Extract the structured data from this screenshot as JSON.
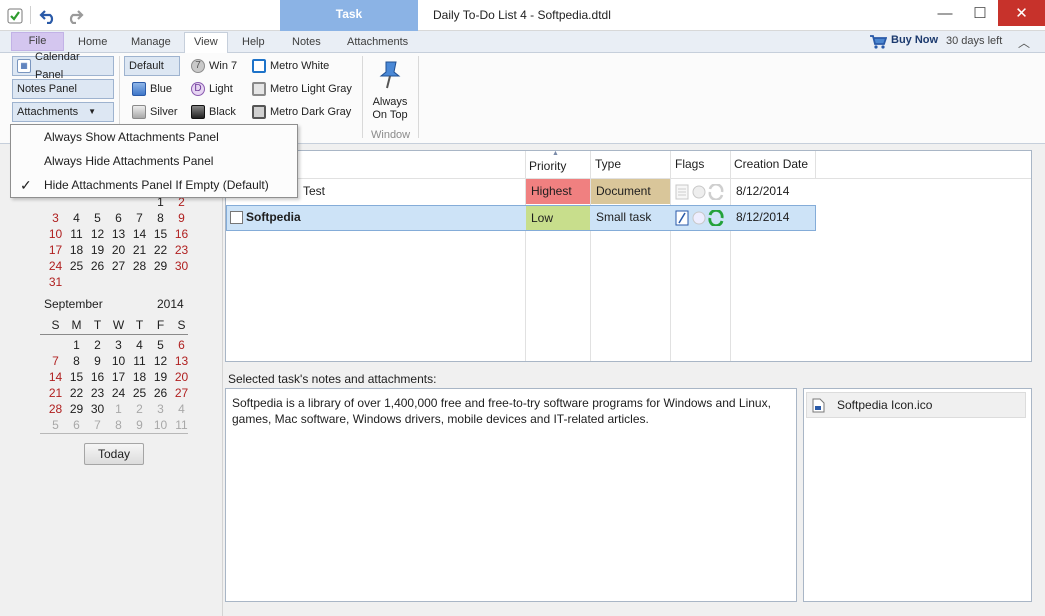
{
  "window": {
    "title": "Daily To-Do List 4 - Softpedia.dtdl",
    "context_tab": "Task",
    "min_glyph": "—",
    "max_glyph": "☐",
    "close_glyph": "✕"
  },
  "ribbon": {
    "tabs": [
      "File",
      "Home",
      "Manage",
      "View",
      "Help",
      "Notes",
      "Attachments"
    ],
    "active_tab": "View",
    "buy_now": "Buy Now",
    "days_left": "30 days left",
    "panels": {
      "calendar_panel": "Calendar Panel",
      "notes_panel": "Notes Panel",
      "attachments": "Attachments"
    },
    "themes": {
      "default": "Default",
      "blue": "Blue",
      "silver": "Silver",
      "win7": "Win 7",
      "light": "Light",
      "black": "Black",
      "metro_white": "Metro White",
      "metro_light_gray": "Metro Light Gray",
      "metro_dark_gray": "Metro Dark Gray"
    },
    "always_on_top_line1": "Always",
    "always_on_top_line2": "On Top",
    "window_group": "Window"
  },
  "dropdown": {
    "items": [
      "Always Show Attachments Panel",
      "Always Hide Attachments Panel",
      "Hide Attachments Panel If Empty (Default)"
    ],
    "checked_index": 2,
    "check_glyph": "✓"
  },
  "calendar": {
    "aug_rows": [
      [
        "",
        "",
        "",
        "",
        "",
        "1",
        "2"
      ],
      [
        "3",
        "4",
        "5",
        "6",
        "7",
        "8",
        "9"
      ],
      [
        "10",
        "11",
        "12",
        "13",
        "14",
        "15",
        "16"
      ],
      [
        "17",
        "18",
        "19",
        "20",
        "21",
        "22",
        "23"
      ],
      [
        "24",
        "25",
        "26",
        "27",
        "28",
        "29",
        "30"
      ],
      [
        "31",
        "",
        "",
        "",
        "",
        "",
        ""
      ]
    ],
    "sep_month": "September",
    "sep_year": "2014",
    "weekdays": [
      "S",
      "M",
      "T",
      "W",
      "T",
      "F",
      "S"
    ],
    "sep_rows": [
      [
        "",
        "1",
        "2",
        "3",
        "4",
        "5",
        "6"
      ],
      [
        "7",
        "8",
        "9",
        "10",
        "11",
        "12",
        "13"
      ],
      [
        "14",
        "15",
        "16",
        "17",
        "18",
        "19",
        "20"
      ],
      [
        "21",
        "22",
        "23",
        "24",
        "25",
        "26",
        "27"
      ],
      [
        "28",
        "29",
        "30",
        "1",
        "2",
        "3",
        "4"
      ],
      [
        "5",
        "6",
        "7",
        "8",
        "9",
        "10",
        "11"
      ]
    ],
    "today_button": "Today"
  },
  "tasks": {
    "columns": [
      "Priority",
      "Type",
      "Flags",
      "Creation Date"
    ],
    "rows": [
      {
        "title": "Test",
        "priority": "Highest",
        "type": "Document",
        "date": "8/12/2014"
      },
      {
        "title": "Softpedia",
        "priority": "Low",
        "type": "Small task",
        "date": "8/12/2014"
      }
    ],
    "colors": {
      "highest": "#f08080",
      "document": "#d9c69a",
      "low": "#c8de8c",
      "selected": "#cde3f7"
    }
  },
  "notes": {
    "label": "Selected task's notes and attachments:",
    "text": "Softpedia is a library of over 1,400,000 free and free-to-try software programs for Windows and Linux, games, Mac software, Windows drivers, mobile devices and IT-related articles.",
    "attachment": "Softpedia Icon.ico"
  }
}
